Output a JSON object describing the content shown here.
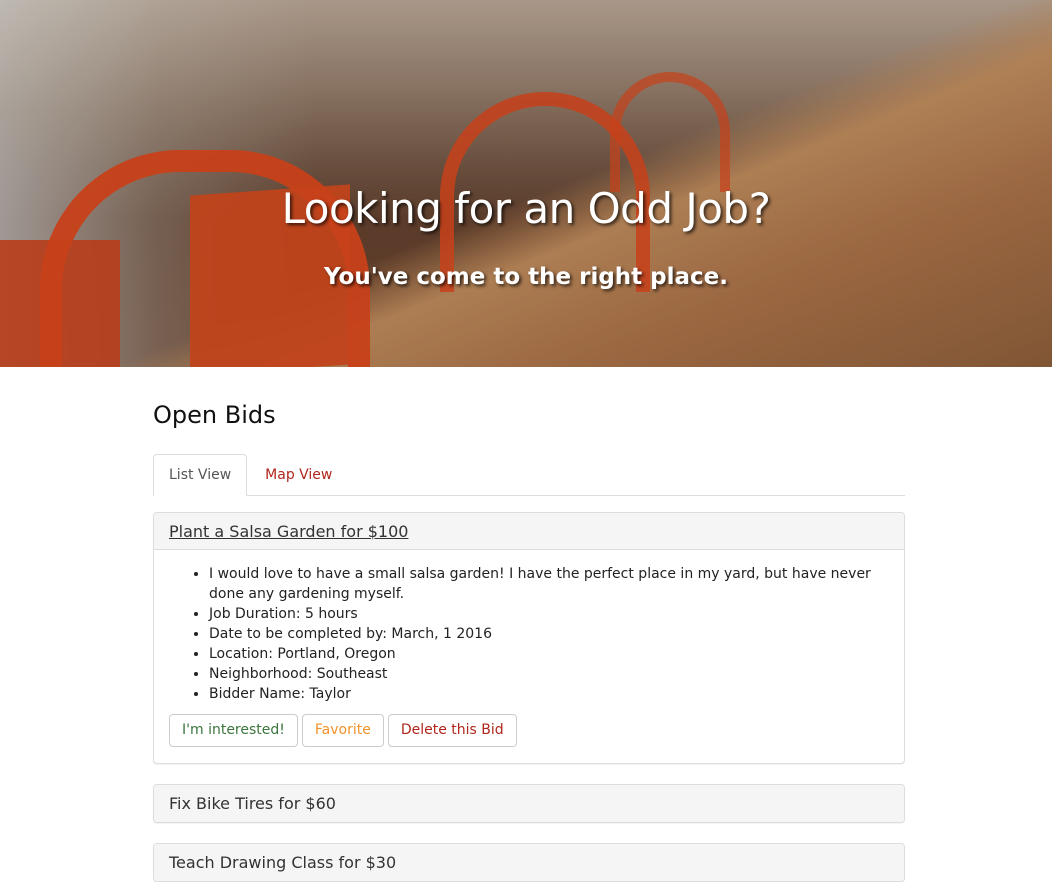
{
  "hero": {
    "title": "Looking for an Odd Job?",
    "subtitle": "You've come to the right place."
  },
  "section": {
    "title": "Open Bids"
  },
  "tabs": [
    {
      "label": "List View",
      "active": true
    },
    {
      "label": "Map View",
      "active": false
    }
  ],
  "bids": [
    {
      "title": "Plant a Salsa Garden for $100",
      "expanded": true,
      "details": [
        "I would love to have a small salsa garden! I have the perfect place in my yard, but have never done any gardening myself.",
        "Job Duration: 5 hours",
        "Date to be completed by: March, 1 2016",
        "Location: Portland, Oregon",
        "Neighborhood: Southeast",
        "Bidder Name: Taylor"
      ],
      "buttons": {
        "interested": "I'm interested!",
        "favorite": "Favorite",
        "delete": "Delete this Bid"
      }
    },
    {
      "title": "Fix Bike Tires for $60",
      "expanded": false
    },
    {
      "title": "Teach Drawing Class for $30",
      "expanded": false
    }
  ],
  "colors": {
    "link_red": "#b0261c",
    "interested_green": "#3c763d",
    "favorite_orange": "#f0932b"
  }
}
